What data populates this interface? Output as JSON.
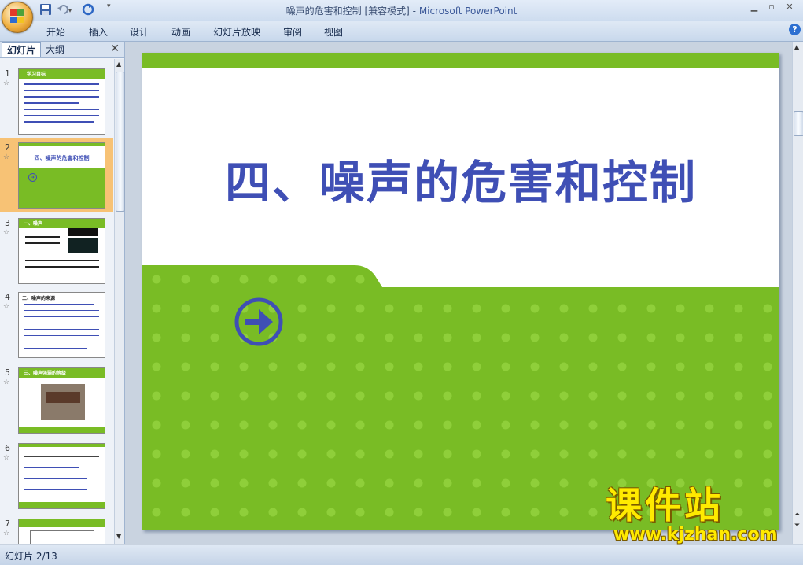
{
  "window": {
    "title_doc": "噪声的危害和控制 [兼容模式]",
    "title_sep": " - ",
    "title_app": "Microsoft PowerPoint"
  },
  "ribbon": {
    "tabs": [
      "开始",
      "插入",
      "设计",
      "动画",
      "幻灯片放映",
      "审阅",
      "视图"
    ]
  },
  "left_panel": {
    "tab_slides": "幻灯片",
    "tab_outline": "大纲",
    "thumbnails": [
      {
        "num": "1",
        "title": "学习目标"
      },
      {
        "num": "2",
        "title": "四、噪声的危害和控制"
      },
      {
        "num": "3",
        "title": "一、噪声"
      },
      {
        "num": "4",
        "title": "二、噪声的来源"
      },
      {
        "num": "5",
        "title": "三、噪声强弱的等级"
      },
      {
        "num": "6",
        "title": ""
      },
      {
        "num": "7",
        "title": ""
      }
    ]
  },
  "slide": {
    "title": "四、噪声的危害和控制"
  },
  "status": {
    "slide_indicator": "幻灯片 2/13"
  },
  "watermark": {
    "main": "课件站",
    "url": "www.kjzhan.com"
  },
  "colors": {
    "accent_green": "#79bc25",
    "title_blue": "#3f4fb5",
    "selected_thumb": "#f7c275"
  }
}
